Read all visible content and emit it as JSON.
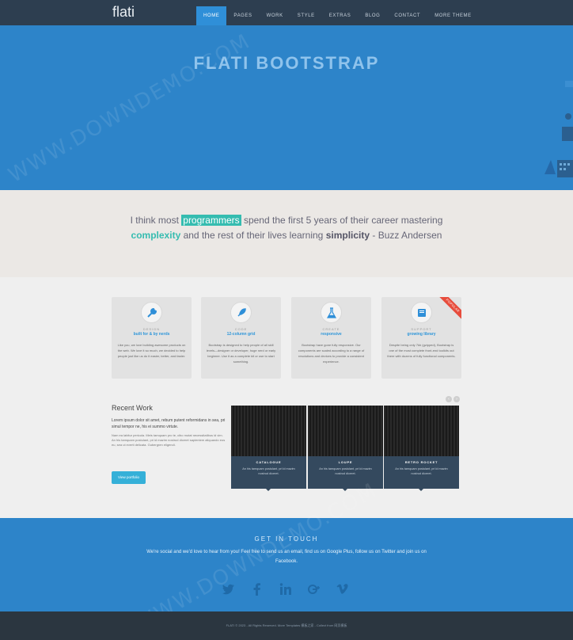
{
  "brand": "flati",
  "nav": [
    "HOME",
    "PAGES",
    "WORK",
    "STYLE",
    "EXTRAS",
    "BLOG",
    "CONTACT",
    "MORE THEME"
  ],
  "hero": {
    "title": "FLATI BOOTSTRAP"
  },
  "quote": {
    "p1": "I think most ",
    "h1": "programmers",
    "p2": " spend the first 5 years of their career mastering ",
    "h2": "complexity",
    "p3": " and the rest of their lives learning ",
    "b1": "simplicity",
    "p4": " - Buzz Andersen"
  },
  "features": [
    {
      "icon": "wrench-icon",
      "kicker": "DESIGN",
      "title": "built for & by nerds",
      "desc": "Like you, we love building awesome products on the web. We love it so much, we decided to help people just like us do it easier, better, and faster."
    },
    {
      "icon": "rocket-icon",
      "kicker": "CODE",
      "title": "12-column grid",
      "desc": "Bootstrap is designed to help people of all skill levels—designer or developer, huge nerd or early beginner. Use it as a complete kit or use to start something."
    },
    {
      "icon": "flask-icon",
      "kicker": "CREATE",
      "title": "responsive",
      "desc": "Bootstrap have gone fully responsive. Our components are scaled according to a range of resolutions and devices to provide a consistent experience."
    },
    {
      "icon": "book-icon",
      "kicker": "SUPPORT",
      "title": "growing library",
      "desc": "Despite being only 7kb (gzipped), Bootstrap is one of the most complete front-end toolkits out there with dozens of fully functional components.",
      "ribbon": "POPULAR"
    }
  ],
  "recent": {
    "title": "Recent Work",
    "lead": "Lorem ipsum dolor sit amet, rebum putent reformidans in sea, pri simul tempor ne, his ei summo virtute.",
    "body": "Nam ea labitur pericula. Meis tamquam pro te, cibo mutat necessitatibus id vim. An his tamquam postulant, pri id mazim nostrud diceret sapientem aliquando eos eu, sea ut everti delicata. Gubergren eligendi.",
    "button": "View portfolio"
  },
  "pager": {
    "prev": "‹",
    "next": "›"
  },
  "works": [
    {
      "title": "CATALOGUE",
      "desc": "An his tamquam postulant, pri id mazim nostrud diceret."
    },
    {
      "title": "LOUPE",
      "desc": "An his tamquam postulant, pri id mazim nostrud diceret."
    },
    {
      "title": "RETRO ROCKET",
      "desc": "An his tamquam postulant, pri id mazim nostrud diceret."
    }
  ],
  "contact": {
    "title": "GET IN TOUCH",
    "text": "We're social and we'd love to hear from you! Feel free to send us an email, find us on Google Plus, follow us on Twitter and join us on Facebook."
  },
  "social": [
    "twitter-icon",
    "facebook-icon",
    "linkedin-icon",
    "google-plus-icon",
    "vimeo-icon"
  ],
  "footer": {
    "text": "FLATI © 2023 - All Rights Reserved. More Templates 模板之家 - Collect from 网页模板"
  },
  "watermark": "WWW.DOWNDEMO.COM",
  "colors": {
    "nav": "#2d3e50",
    "hero": "#2d84c9",
    "accent": "#35bcb0",
    "link": "#2f96d9",
    "footer": "#2b3640"
  }
}
